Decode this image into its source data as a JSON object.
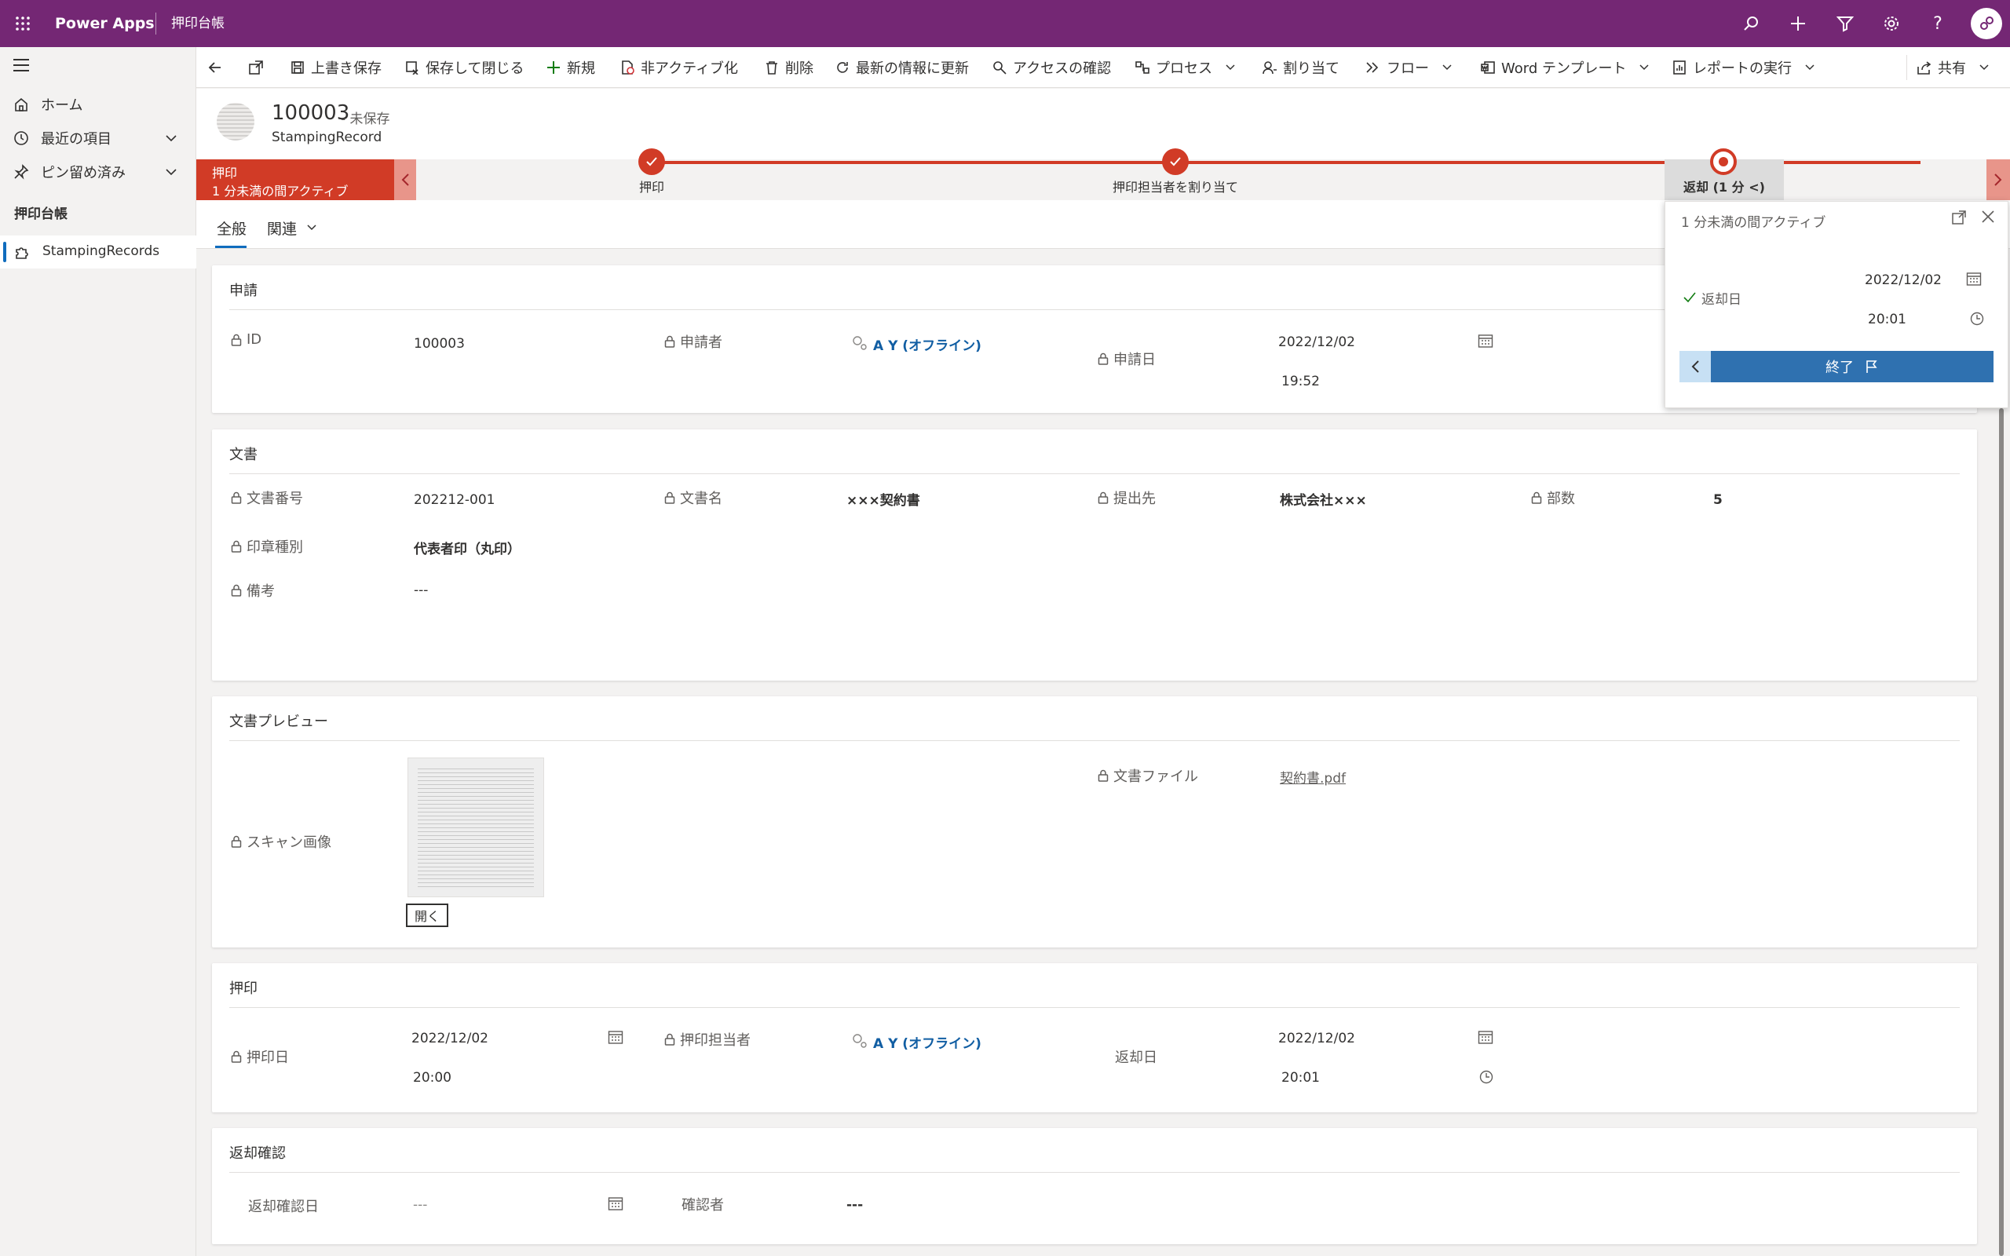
{
  "app": {
    "name": "Power Apps",
    "module": "押印台帳"
  },
  "top_icons": [
    "search-icon",
    "plus-icon",
    "filter-icon",
    "settings-icon",
    "help-icon",
    "avatar-icon"
  ],
  "sidebar": {
    "items": [
      {
        "label": "ホーム",
        "icon": "home-icon"
      },
      {
        "label": "最近の項目",
        "icon": "clock-icon"
      },
      {
        "label": "ピン留め済み",
        "icon": "pin-icon"
      }
    ],
    "group_title": "押印台帳",
    "entity": "StampingRecords"
  },
  "commands": {
    "save": "上書き保存",
    "save_close": "保存して閉じる",
    "new": "新規",
    "deactivate": "非アクティブ化",
    "delete": "削除",
    "refresh": "最新の情報に更新",
    "access": "アクセスの確認",
    "process": "プロセス",
    "assign": "割り当て",
    "flow": "フロー",
    "word": "Word テンプレート",
    "report": "レポートの実行",
    "share": "共有"
  },
  "record": {
    "id": "100003",
    "status": "- 未保存",
    "entity": "StampingRecord"
  },
  "bpf": {
    "active_stage": "押印",
    "active_duration": "1 分未満の間アクティブ",
    "stages": [
      "押印",
      "押印担当者を割り当て",
      "返却 (1 分 <)"
    ],
    "colors": {
      "accent": "#d13b26",
      "completed": "#d13b26"
    }
  },
  "flyout": {
    "title": "1 分未満の間アクティブ",
    "field_label": "返却日",
    "date": "2022/12/02",
    "time": "20:01",
    "finish": "終了"
  },
  "tabs": {
    "general": "全般",
    "related": "関連"
  },
  "sec_request": {
    "title": "申請",
    "id_label": "ID",
    "id_value": "100003",
    "applicant_label": "申請者",
    "applicant_value": "A Y (オフライン)",
    "date_label": "申請日",
    "date_value": "2022/12/02",
    "time_value": "19:52"
  },
  "sec_doc": {
    "title": "文書",
    "docno_label": "文書番号",
    "docno_value": "202212-001",
    "docname_label": "文書名",
    "docname_value": "×××契約書",
    "dest_label": "提出先",
    "dest_value": "株式会社×××",
    "copies_label": "部数",
    "copies_value": "5",
    "seal_label": "印章種別",
    "seal_value": "代表者印（丸印）",
    "note_label": "備考",
    "note_value": "---"
  },
  "sec_preview": {
    "title": "文書プレビュー",
    "scan_label": "スキャン画像",
    "open_button": "開く",
    "file_label": "文書ファイル",
    "file_value": "契約書.pdf"
  },
  "sec_stamp": {
    "title": "押印",
    "stamp_date_label": "押印日",
    "stamp_date": "2022/12/02",
    "stamp_time": "20:00",
    "stamper_label": "押印担当者",
    "stamper_value": "A Y (オフライン)",
    "return_label": "返却日",
    "return_date": "2022/12/02",
    "return_time": "20:01"
  },
  "sec_confirm": {
    "title": "返却確認",
    "confirm_date_label": "返却確認日",
    "confirm_date_value": "---",
    "confirmer_label": "確認者",
    "confirmer_value": "---"
  }
}
